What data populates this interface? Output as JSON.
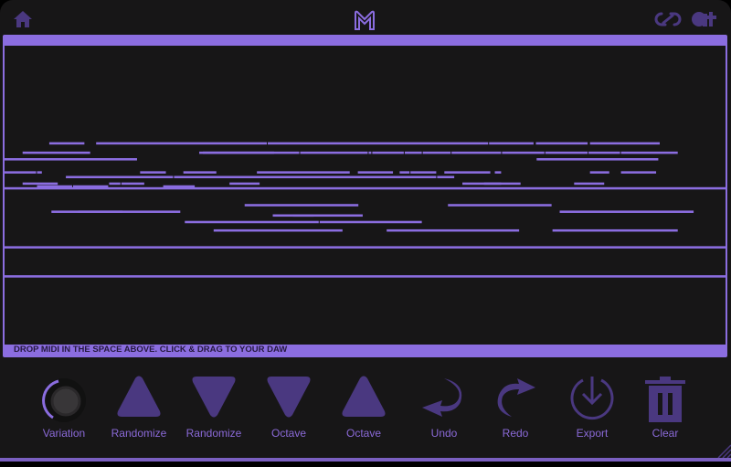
{
  "header": {
    "home_icon": "home-icon",
    "logo_icon": "m-logo-icon",
    "link_icon": "infinity-link-icon",
    "brand_icon": "at-brand-icon"
  },
  "piano_roll": {
    "footer_text": "DROP MIDI IN THE SPACE ABOVE. CLICK & DRAG TO YOUR DAW",
    "notes_note": "note bars: [row, start, end] in roll-relative units (0-1000 horizontal)"
  },
  "notes": [
    [
      1,
      62,
      112
    ],
    [
      1,
      127,
      365
    ],
    [
      1,
      365,
      672
    ],
    [
      1,
      672,
      735
    ],
    [
      1,
      737,
      810
    ],
    [
      1,
      812,
      910
    ],
    [
      2,
      25,
      120
    ],
    [
      2,
      270,
      375
    ],
    [
      2,
      275,
      410
    ],
    [
      2,
      410,
      505
    ],
    [
      2,
      505,
      510
    ],
    [
      2,
      510,
      555
    ],
    [
      2,
      555,
      580
    ],
    [
      2,
      580,
      620
    ],
    [
      2,
      620,
      690
    ],
    [
      2,
      690,
      750
    ],
    [
      2,
      750,
      810
    ],
    [
      2,
      810,
      855
    ],
    [
      2,
      855,
      935
    ],
    [
      3,
      0,
      185
    ],
    [
      3,
      738,
      908
    ],
    [
      4,
      0,
      45
    ],
    [
      4,
      45,
      53
    ],
    [
      4,
      188,
      225
    ],
    [
      4,
      248,
      295
    ],
    [
      4,
      350,
      480
    ],
    [
      4,
      490,
      540
    ],
    [
      4,
      548,
      563
    ],
    [
      4,
      563,
      600
    ],
    [
      4,
      610,
      675
    ],
    [
      4,
      680,
      690
    ],
    [
      4,
      812,
      840
    ],
    [
      4,
      855,
      905
    ],
    [
      5,
      85,
      235
    ],
    [
      5,
      235,
      600
    ],
    [
      5,
      600,
      625
    ],
    [
      6,
      25,
      75
    ],
    [
      6,
      145,
      162
    ],
    [
      6,
      162,
      195
    ],
    [
      6,
      312,
      355
    ],
    [
      6,
      635,
      690
    ],
    [
      6,
      665,
      717
    ],
    [
      6,
      790,
      833
    ],
    [
      7,
      45,
      95
    ],
    [
      7,
      95,
      145
    ],
    [
      7,
      220,
      265
    ],
    [
      8,
      333,
      492
    ],
    [
      8,
      615,
      760
    ],
    [
      9,
      65,
      245
    ],
    [
      9,
      102,
      165
    ],
    [
      9,
      770,
      957
    ],
    [
      10,
      372,
      430
    ],
    [
      10,
      400,
      498
    ],
    [
      11,
      250,
      437
    ],
    [
      11,
      437,
      580
    ],
    [
      12,
      290,
      470
    ],
    [
      12,
      530,
      715
    ],
    [
      12,
      760,
      935
    ]
  ],
  "long_lines": [
    {
      "row": "a",
      "label": "sustained-note-1"
    },
    {
      "row": "b",
      "label": "sustained-note-2"
    },
    {
      "row": "c",
      "label": "sustained-note-3"
    }
  ],
  "controls": [
    {
      "id": "variation",
      "label": "Variation",
      "icon": "knob-icon",
      "value": 0.35
    },
    {
      "id": "randomize-up",
      "label": "Randomize",
      "icon": "triangle-up-icon"
    },
    {
      "id": "randomize-down",
      "label": "Randomize",
      "icon": "triangle-down-icon"
    },
    {
      "id": "octave-down",
      "label": "Octave",
      "icon": "triangle-down-icon"
    },
    {
      "id": "octave-up",
      "label": "Octave",
      "icon": "triangle-up-icon"
    },
    {
      "id": "undo",
      "label": "Undo",
      "icon": "undo-arrow-icon"
    },
    {
      "id": "redo",
      "label": "Redo",
      "icon": "redo-arrow-icon"
    },
    {
      "id": "export",
      "label": "Export",
      "icon": "download-circle-icon"
    },
    {
      "id": "clear",
      "label": "Clear",
      "icon": "trash-icon"
    }
  ],
  "colors": {
    "accent": "#8b6de0",
    "icon": "#4a3880",
    "label": "#8b6ad8",
    "background": "#171617"
  }
}
